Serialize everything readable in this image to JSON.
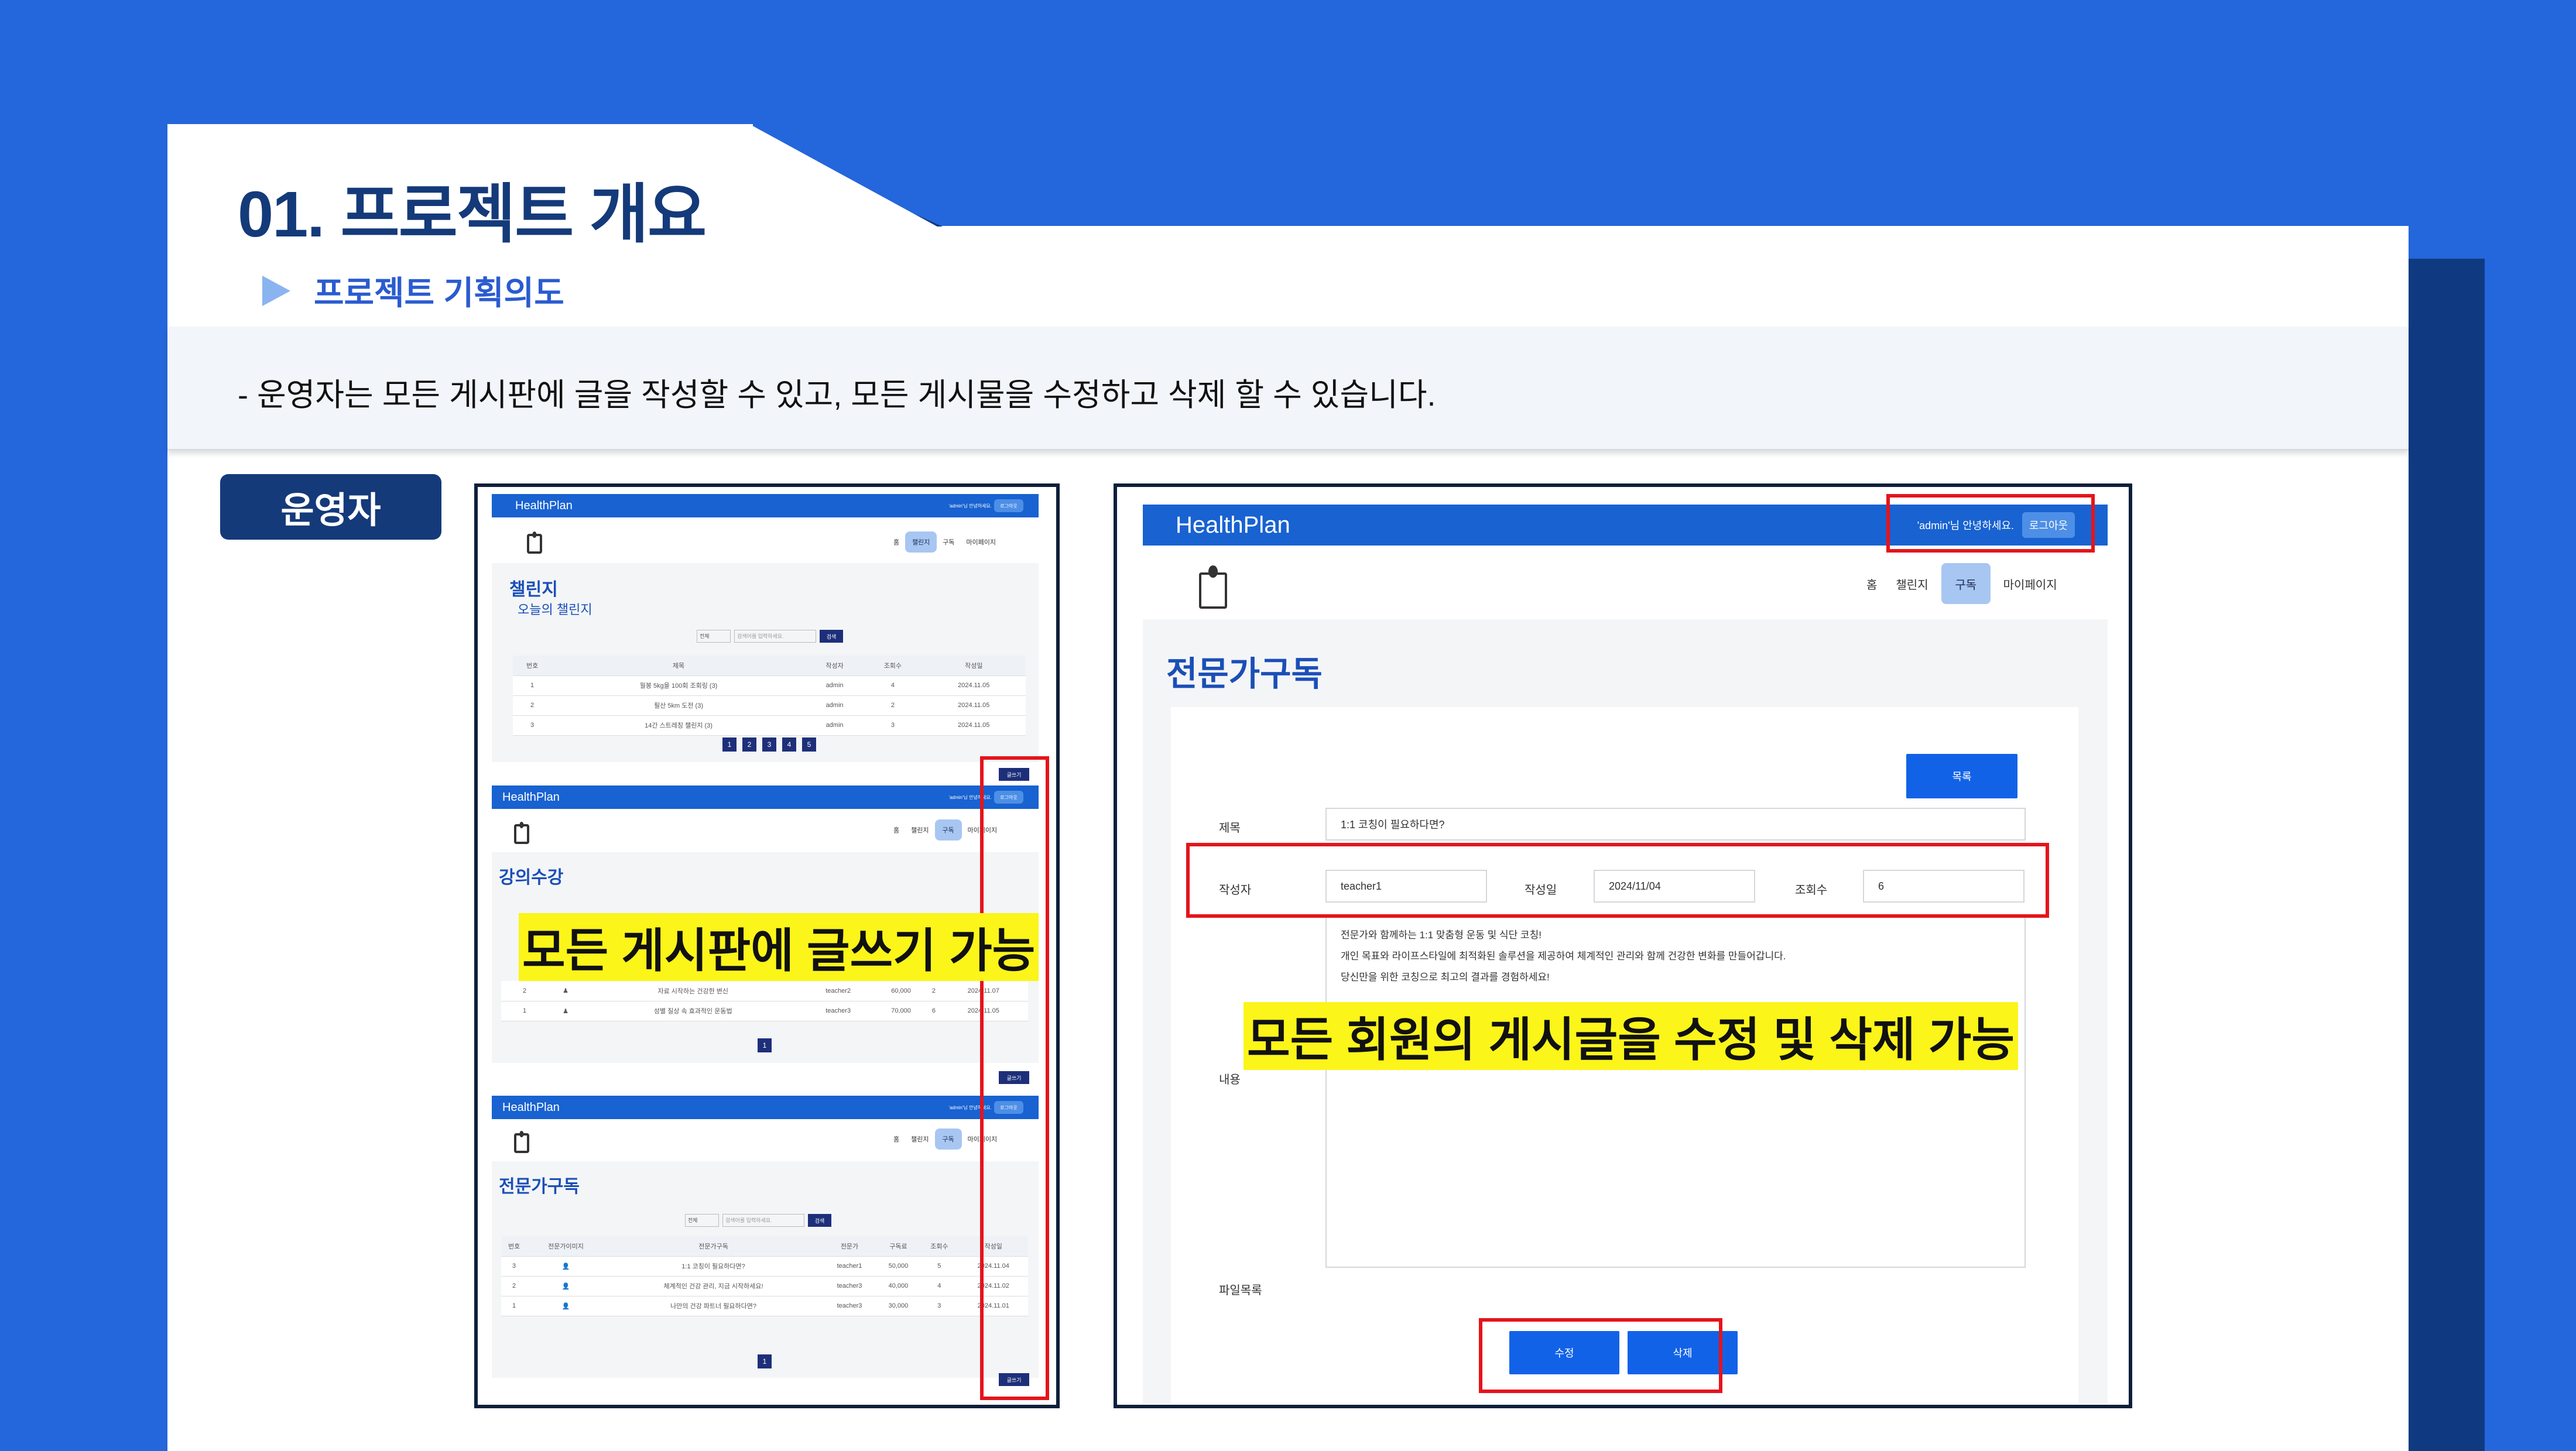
{
  "slide": {
    "title": "01. 프로젝트 개요",
    "subtitle": "프로젝트 기획의도",
    "note": "-   운영자는 모든 게시판에 글을 작성할 수 있고, 모든 게시물을 수정하고 삭제 할 수 있습니다.",
    "role_badge": "운영자",
    "highlight_left": "모든 게시판에 글쓰기 가능",
    "highlight_right": "모든 회원의 게시글을 수정 및 삭제 가능"
  },
  "app": {
    "brand": "HealthPlan",
    "welcome": "'admin'님 안녕하세요.",
    "logout": "로그아웃",
    "nav": [
      "홈",
      "챌린지",
      "구독",
      "마이페이지"
    ]
  },
  "challenge": {
    "title": "챌린지",
    "subtitle": "오늘의 챌린지",
    "search_select": "전체",
    "search_placeholder": "검색어를 입력하세요.",
    "search_btn": "검색",
    "columns": [
      "번호",
      "제목",
      "작성자",
      "조회수",
      "작성일"
    ],
    "rows": [
      [
        "1",
        "월봉 5kg을 100회 조회링 (3)",
        "admin",
        "4",
        "2024.11.05"
      ],
      [
        "2",
        "필산 5km 도전 (3)",
        "admin",
        "2",
        "2024.11.05"
      ],
      [
        "3",
        "14간 스트레칭 챌린지 (3)",
        "admin",
        "3",
        "2024.11.05"
      ]
    ],
    "pages": [
      "1",
      "2",
      "3",
      "4",
      "5"
    ],
    "write_btn": "글쓰기"
  },
  "lecture": {
    "title": "강의수강",
    "rows": [
      [
        "2",
        "자료 시작하는 건강한 변신",
        "teacher2",
        "60,000",
        "2",
        "2024.11.07"
      ],
      [
        "1",
        "성별 질상 속 효과적인 운동법",
        "teacher3",
        "70,000",
        "6",
        "2024.11.05"
      ]
    ],
    "pages": [
      "1"
    ],
    "write_btn": "글쓰기"
  },
  "expert": {
    "title": "전문가구독",
    "search_select": "전체",
    "search_placeholder": "검색어를 입력하세요.",
    "search_btn": "검색",
    "columns": [
      "번호",
      "전문가이미지",
      "전문가구독",
      "전문가",
      "구독료",
      "조회수",
      "작성일"
    ],
    "rows": [
      [
        "3",
        "1:1 코칭이 필요하다면?",
        "teacher1",
        "50,000",
        "5",
        "2024.11.04"
      ],
      [
        "2",
        "체계적인 건강 관리, 지금 시작하세요!",
        "teacher3",
        "40,000",
        "4",
        "2024.11.02"
      ],
      [
        "1",
        "나만의 건강 파트너 필요하다면?",
        "teacher3",
        "30,000",
        "3",
        "2024.11.01"
      ]
    ],
    "pages": [
      "1"
    ],
    "write_btn": "글쓰기"
  },
  "detail": {
    "title": "전문가구독",
    "list_btn": "목록",
    "label_title": "제목",
    "value_title": "1:1 코칭이 필요하다면?",
    "label_author": "작성자",
    "value_author": "teacher1",
    "label_date": "작성일",
    "value_date": "2024/11/04",
    "label_views": "조회수",
    "value_views": "6",
    "label_content": "내용",
    "content": [
      "전문가와 함께하는 1:1 맞춤형 운동 및 식단 코칭!",
      "개인 목표와 라이프스타일에 최적화된 솔루션을 제공하여 체계적인 관리와 함께 건강한 변화를 만들어갑니다.",
      "당신만을 위한 코칭으로 최고의 결과를 경험하세요!"
    ],
    "label_files": "파일목록",
    "edit_btn": "수정",
    "delete_btn": "삭제"
  }
}
